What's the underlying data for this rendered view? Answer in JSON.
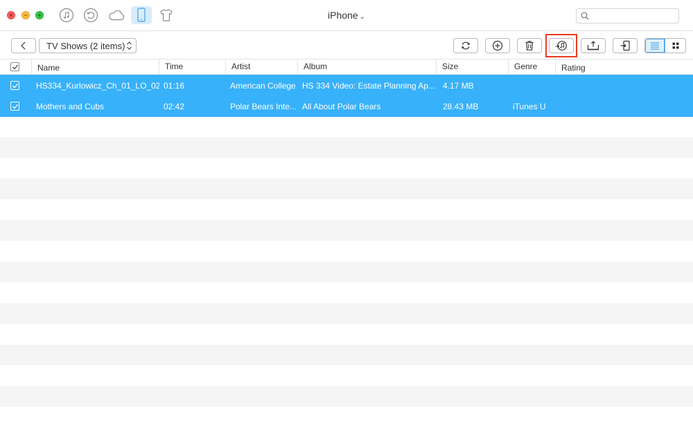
{
  "window": {
    "title": "iPhone",
    "title_chevron": "⌄"
  },
  "top_icons": [
    "music-icon",
    "restore-icon",
    "cloud-icon",
    "iphone-icon",
    "tshirt-icon"
  ],
  "search": {
    "placeholder": "",
    "value": ""
  },
  "toolbar": {
    "category_label": "TV Shows (2 items)",
    "buttons": [
      "refresh",
      "add",
      "delete",
      "to-itunes",
      "to-computer",
      "to-device"
    ],
    "view_mode": "list"
  },
  "table": {
    "columns": [
      "Name",
      "Time",
      "Artist",
      "Album",
      "Size",
      "Genre",
      "Rating"
    ],
    "header_checked": true,
    "rows": [
      {
        "checked": true,
        "name": "HS334_Kurlowicz_Ch_01_LO_02",
        "time": "01:16",
        "artist": "American College",
        "album": "HS 334 Video: Estate Planning Ap...",
        "size": "4.17 MB",
        "genre": "",
        "rating": ""
      },
      {
        "checked": true,
        "name": "Mothers and Cubs",
        "time": "02:42",
        "artist": "Polar Bears Inte...",
        "album": "All About Polar Bears",
        "size": "28.43 MB",
        "genre": "iTunes U",
        "rating": ""
      }
    ]
  },
  "colors": {
    "selection": "#37b1fa",
    "stripe": "#f5f5f5",
    "highlight_box": "#e8391d",
    "active_tab": "#d9ecfb"
  }
}
